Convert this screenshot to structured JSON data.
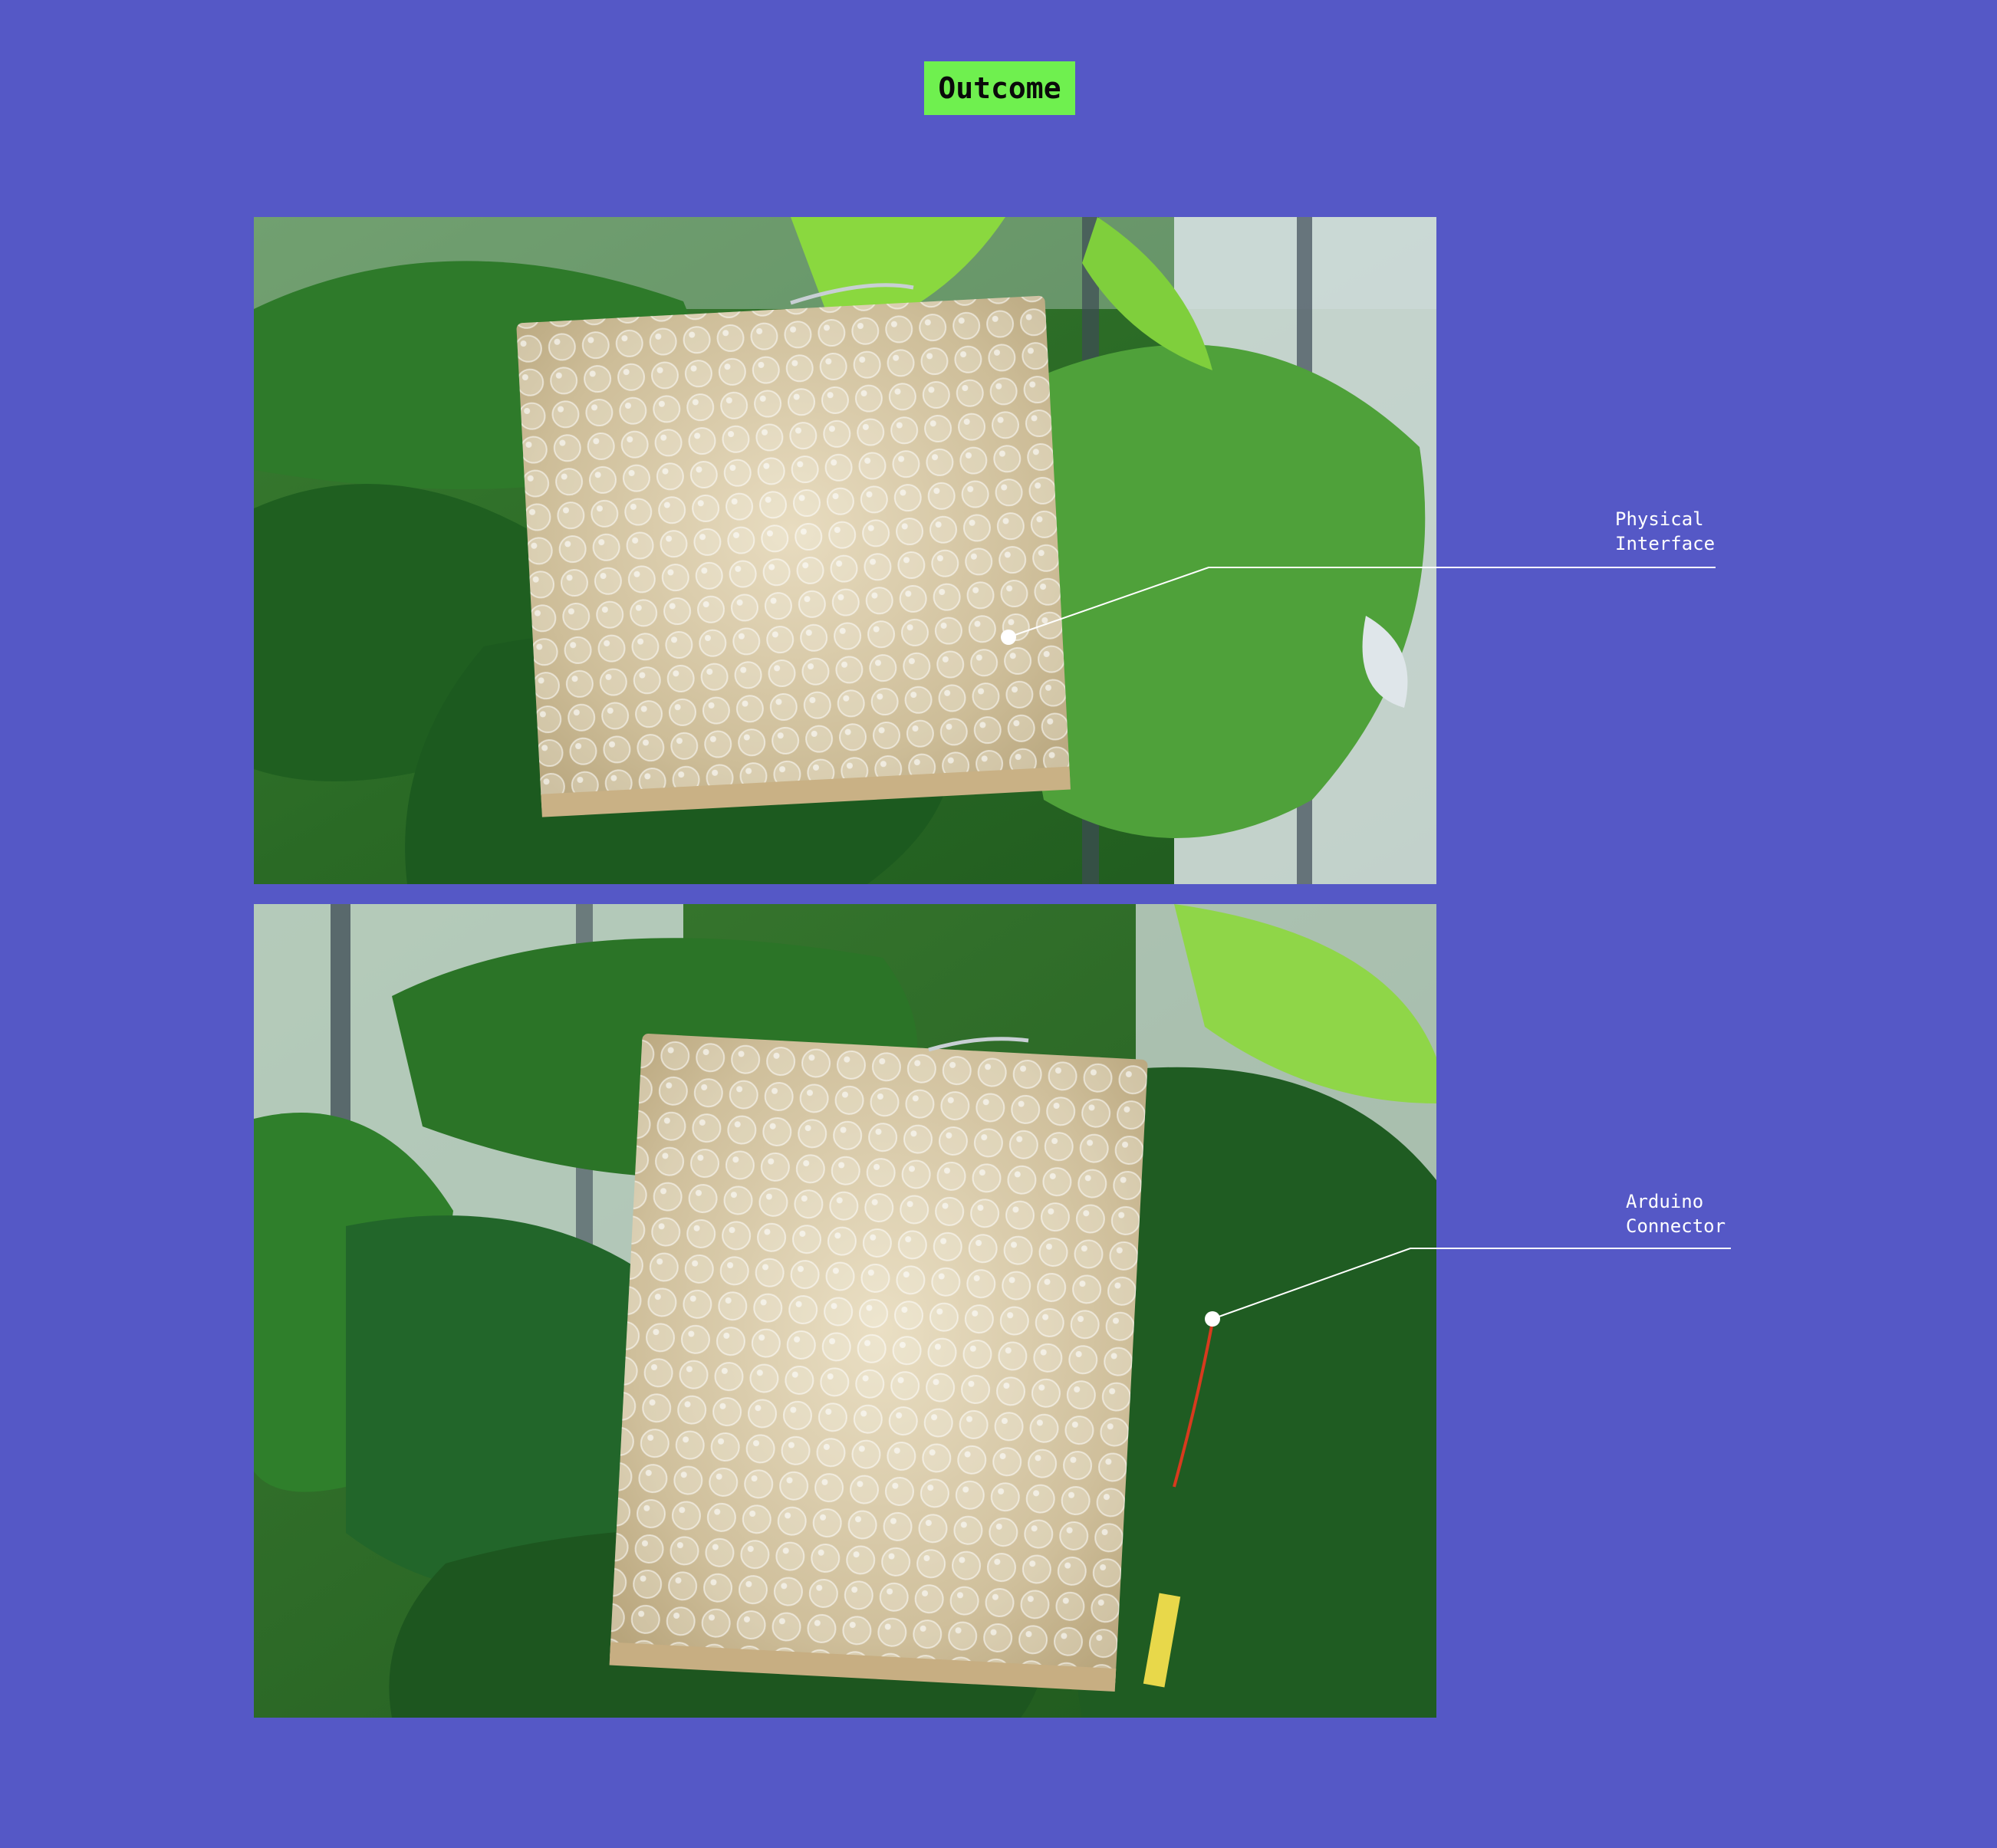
{
  "title": "Outcome",
  "images": [
    {
      "name": "bubble-wrap-interface-photo-top",
      "annotation": {
        "line1": "Physical",
        "line2": "Interface"
      }
    },
    {
      "name": "bubble-wrap-interface-photo-bottom",
      "annotation": {
        "line1": "Arduino",
        "line2": "Connector"
      }
    }
  ],
  "colors": {
    "background": "#5558c6",
    "title_badge": "#6ff04f",
    "annotation": "#ffffff"
  }
}
